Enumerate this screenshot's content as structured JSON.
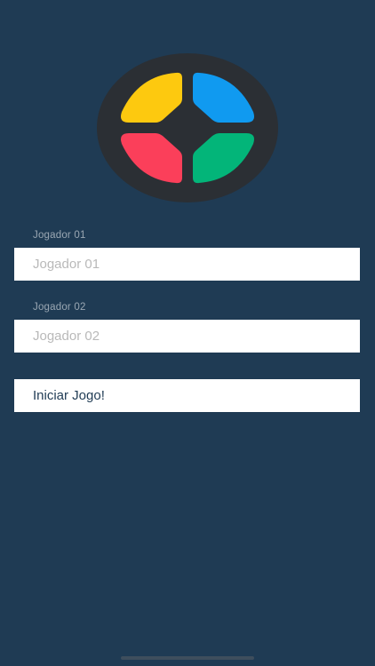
{
  "logo": {
    "name": "simon-game-logo",
    "colors": {
      "ring": "#2b2f34",
      "top_left": "#fdc90f",
      "top_right": "#109af0",
      "bottom_left": "#fb3f5a",
      "bottom_right": "#03b579"
    }
  },
  "player1": {
    "label": "Jogador 01",
    "placeholder": "Jogador 01",
    "value": ""
  },
  "player2": {
    "label": "Jogador 02",
    "placeholder": "Jogador 02",
    "value": ""
  },
  "start_button": {
    "label": "Iniciar Jogo!"
  },
  "theme": {
    "background": "#1f3b54",
    "field_background": "#ffffff",
    "label_color": "#9aa7b3",
    "placeholder_color": "#b9b9b9",
    "button_text_color": "#1f3b54"
  }
}
